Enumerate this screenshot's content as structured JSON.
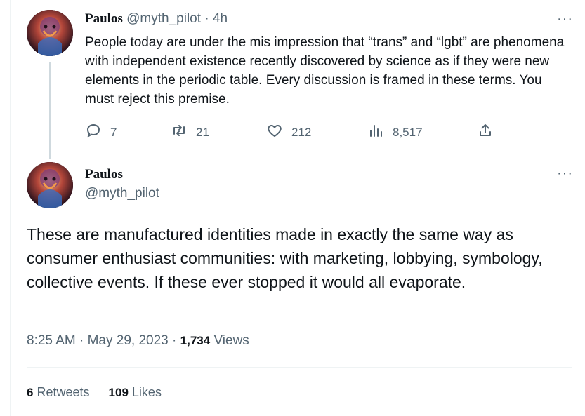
{
  "tweet1": {
    "name": "Paulos",
    "handle": "@myth_pilot",
    "time": "4h",
    "separator": "·",
    "text": "People today are under the mis impression that “trans” and “lgbt” are phenomena with independent existence recently discovered by science as if they were new elements in the periodic table. Every discussion is framed in these terms. You must reject this premise.",
    "more": "···",
    "actions": {
      "replies": "7",
      "retweets": "21",
      "likes": "212",
      "views": "8,517"
    }
  },
  "tweet2": {
    "name": "Paulos",
    "handle": "@myth_pilot",
    "more": "···",
    "text": "These are manufactured identities made in exactly the same way as consumer enthusiast communities: with marketing, lobbying, symbology, collective events. If these ever stopped it would all evaporate.",
    "time": "8:25 AM",
    "date": "May 29, 2023",
    "views_count": "1,734",
    "views_label": "Views",
    "retweets_count": "6",
    "retweets_label": "Retweets",
    "likes_count": "109",
    "likes_label": "Likes"
  },
  "icons": [
    "avatar",
    "reply-icon",
    "retweet-icon",
    "like-icon",
    "views-icon",
    "share-icon",
    "more-icon"
  ],
  "colors": {
    "text": "#0f1419",
    "muted": "#536471",
    "divider": "#eff3f4",
    "thread": "#cfd9de"
  }
}
